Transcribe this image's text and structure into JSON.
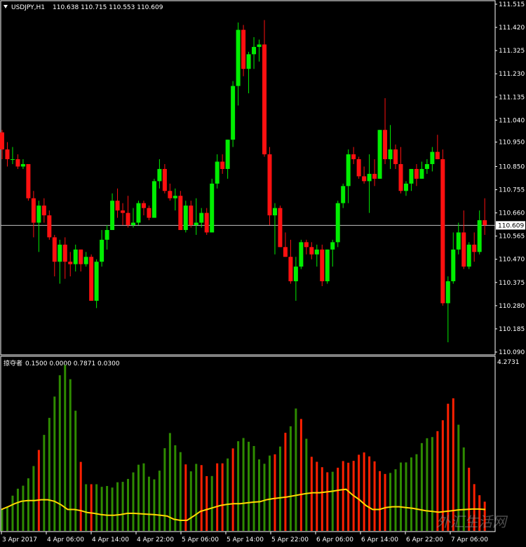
{
  "header": {
    "symbol": "USDJPY,H1",
    "ohlc": "110.638 110.715 110.553 110.609"
  },
  "indicator": {
    "name": "掠夺者",
    "params": "0.1500 0.0000 0.7871 0.0300",
    "max_label": "4.2731"
  },
  "watermark": "外汇生活网",
  "colors": {
    "background": "#000000",
    "bull": "#00ee00",
    "bear": "#ff1010",
    "bull_volume": "#2e8b00",
    "bear_volume": "#ff2000",
    "signal": "#ffd700",
    "price_line": "#c0c0c0",
    "label_box": "#ffffff"
  },
  "chart_data": [
    {
      "type": "candlestick",
      "title": "USDJPY,H1",
      "ylim": [
        110.09,
        111.515
      ],
      "yticks": [
        "111.515",
        "111.420",
        "111.325",
        "111.230",
        "111.135",
        "111.040",
        "110.950",
        "110.850",
        "110.755",
        "110.660",
        "110.565",
        "110.470",
        "110.375",
        "110.280",
        "110.185",
        "110.090"
      ],
      "current_price": "110.609",
      "xticks": [
        "3 Apr 2017",
        "4 Apr 06:00",
        "4 Apr 14:00",
        "4 Apr 22:00",
        "5 Apr 06:00",
        "5 Apr 14:00",
        "5 Apr 22:00",
        "6 Apr 06:00",
        "6 Apr 14:00",
        "6 Apr 22:00",
        "7 Apr 06:00"
      ],
      "ohlc": [
        [
          110.99,
          111.0,
          110.88,
          110.92
        ],
        [
          110.92,
          110.95,
          110.85,
          110.88
        ],
        [
          110.88,
          110.93,
          110.86,
          110.88
        ],
        [
          110.88,
          110.9,
          110.84,
          110.85
        ],
        [
          110.85,
          110.88,
          110.84,
          110.86
        ],
        [
          110.86,
          110.86,
          110.71,
          110.72
        ],
        [
          110.72,
          110.75,
          110.56,
          110.62
        ],
        [
          110.62,
          110.71,
          110.5,
          110.69
        ],
        [
          110.69,
          110.72,
          110.62,
          110.65
        ],
        [
          110.65,
          110.67,
          110.55,
          110.56
        ],
        [
          110.56,
          110.57,
          110.4,
          110.46
        ],
        [
          110.46,
          110.55,
          110.37,
          110.53
        ],
        [
          110.53,
          110.56,
          110.39,
          110.46
        ],
        [
          110.46,
          110.5,
          110.4,
          110.45
        ],
        [
          110.45,
          110.53,
          110.42,
          110.51
        ],
        [
          110.51,
          110.51,
          110.42,
          110.45
        ],
        [
          110.45,
          110.5,
          110.44,
          110.48
        ],
        [
          110.48,
          110.49,
          110.3,
          110.3
        ],
        [
          110.3,
          110.47,
          110.27,
          110.46
        ],
        [
          110.46,
          110.59,
          110.44,
          110.55
        ],
        [
          110.55,
          110.61,
          110.51,
          110.59
        ],
        [
          110.59,
          110.74,
          110.59,
          110.71
        ],
        [
          110.71,
          110.76,
          110.64,
          110.67
        ],
        [
          110.67,
          110.7,
          110.61,
          110.66
        ],
        [
          110.66,
          110.73,
          110.6,
          110.61
        ],
        [
          110.61,
          110.68,
          110.6,
          110.62
        ],
        [
          110.62,
          110.71,
          110.61,
          110.7
        ],
        [
          110.7,
          110.71,
          110.65,
          110.68
        ],
        [
          110.68,
          110.69,
          110.63,
          110.64
        ],
        [
          110.64,
          110.8,
          110.64,
          110.79
        ],
        [
          110.79,
          110.88,
          110.76,
          110.84
        ],
        [
          110.84,
          110.86,
          110.74,
          110.75
        ],
        [
          110.75,
          110.78,
          110.71,
          110.72
        ],
        [
          110.72,
          110.76,
          110.67,
          110.73
        ],
        [
          110.73,
          110.75,
          110.59,
          110.59
        ],
        [
          110.59,
          110.71,
          110.58,
          110.69
        ],
        [
          110.69,
          110.71,
          110.6,
          110.61
        ],
        [
          110.61,
          110.72,
          110.57,
          110.62
        ],
        [
          110.62,
          110.68,
          110.6,
          110.66
        ],
        [
          110.66,
          110.68,
          110.57,
          110.58
        ],
        [
          110.58,
          110.8,
          110.58,
          110.78
        ],
        [
          110.78,
          110.9,
          110.76,
          110.87
        ],
        [
          110.87,
          110.9,
          110.82,
          110.84
        ],
        [
          110.84,
          110.96,
          110.8,
          110.96
        ],
        [
          110.96,
          111.2,
          110.93,
          111.18
        ],
        [
          111.18,
          111.44,
          111.1,
          111.41
        ],
        [
          111.41,
          111.43,
          111.22,
          111.25
        ],
        [
          111.25,
          111.32,
          111.15,
          111.31
        ],
        [
          111.31,
          111.38,
          111.25,
          111.34
        ],
        [
          111.34,
          111.37,
          111.28,
          111.35
        ],
        [
          111.35,
          111.45,
          110.89,
          110.9
        ],
        [
          110.9,
          110.93,
          110.61,
          110.65
        ],
        [
          110.65,
          110.7,
          110.49,
          110.68
        ],
        [
          110.68,
          110.69,
          110.52,
          110.52
        ],
        [
          110.52,
          110.58,
          110.48,
          110.48
        ],
        [
          110.48,
          110.55,
          110.37,
          110.38
        ],
        [
          110.38,
          110.48,
          110.3,
          110.44
        ],
        [
          110.44,
          110.55,
          110.43,
          110.54
        ],
        [
          110.54,
          110.55,
          110.49,
          110.52
        ],
        [
          110.52,
          110.54,
          110.47,
          110.49
        ],
        [
          110.49,
          110.53,
          110.44,
          110.51
        ],
        [
          110.51,
          110.53,
          110.36,
          110.38
        ],
        [
          110.38,
          110.51,
          110.37,
          110.51
        ],
        [
          110.51,
          110.55,
          110.44,
          110.54
        ],
        [
          110.54,
          110.71,
          110.52,
          110.7
        ],
        [
          110.7,
          110.78,
          110.68,
          110.77
        ],
        [
          110.77,
          110.92,
          110.7,
          110.9
        ],
        [
          110.9,
          110.93,
          110.86,
          110.88
        ],
        [
          110.88,
          110.89,
          110.8,
          110.81
        ],
        [
          110.81,
          110.85,
          110.78,
          110.79
        ],
        [
          110.79,
          110.9,
          110.66,
          110.82
        ],
        [
          110.82,
          110.88,
          110.77,
          110.8
        ],
        [
          110.8,
          111.0,
          110.8,
          111.0
        ],
        [
          111.0,
          111.13,
          110.86,
          110.88
        ],
        [
          110.88,
          111.02,
          110.84,
          110.92
        ],
        [
          110.92,
          110.94,
          110.84,
          110.86
        ],
        [
          110.86,
          110.93,
          110.74,
          110.75
        ],
        [
          110.75,
          110.79,
          110.73,
          110.78
        ],
        [
          110.78,
          110.84,
          110.75,
          110.84
        ],
        [
          110.84,
          110.86,
          110.77,
          110.8
        ],
        [
          110.8,
          110.87,
          110.8,
          110.84
        ],
        [
          110.84,
          110.88,
          110.82,
          110.86
        ],
        [
          110.86,
          110.93,
          110.83,
          110.91
        ],
        [
          110.91,
          110.98,
          110.88,
          110.88
        ],
        [
          110.88,
          110.92,
          110.28,
          110.29
        ],
        [
          110.29,
          110.4,
          110.13,
          110.38
        ],
        [
          110.38,
          110.58,
          110.37,
          110.51
        ],
        [
          110.51,
          110.62,
          110.49,
          110.58
        ],
        [
          110.58,
          110.67,
          110.43,
          110.44
        ],
        [
          110.44,
          110.54,
          110.43,
          110.53
        ],
        [
          110.53,
          110.58,
          110.46,
          110.5
        ],
        [
          110.5,
          110.67,
          110.49,
          110.63
        ],
        [
          110.63,
          110.72,
          110.57,
          110.61
        ]
      ]
    },
    {
      "type": "bar",
      "title": "掠夺者",
      "ylim": [
        0,
        4.2731
      ],
      "bar_colors": [
        "green",
        "green",
        "green",
        "green",
        "green",
        "green",
        "green",
        "red",
        "green",
        "green",
        "green",
        "green",
        "green",
        "green",
        "green",
        "red",
        "green",
        "red",
        "green",
        "green",
        "green",
        "green",
        "green",
        "green",
        "green",
        "green",
        "green",
        "green",
        "green",
        "green",
        "green",
        "green",
        "green",
        "green",
        "green",
        "red",
        "green",
        "green",
        "red",
        "red",
        "green",
        "red",
        "red",
        "green",
        "red",
        "green",
        "green",
        "green",
        "green",
        "green",
        "green",
        "green",
        "red",
        "green",
        "red",
        "green",
        "green",
        "red",
        "green",
        "red",
        "red",
        "red",
        "red",
        "green",
        "red",
        "red",
        "red",
        "red",
        "red",
        "red",
        "red",
        "red",
        "red",
        "red",
        "green",
        "green",
        "green",
        "green",
        "green",
        "green",
        "green",
        "green",
        "green",
        "red",
        "red",
        "red",
        "red",
        "green",
        "green",
        "red",
        "red",
        "red",
        "red"
      ],
      "values": [
        2.06,
        2.32,
        3.39,
        4.06,
        4.35,
        5.06,
        6.24,
        7.79,
        9.24,
        10.88,
        12.93,
        14.98,
        15.97,
        14.6,
        11.57,
        6.64,
        4.49,
        4.49,
        4.49,
        4.24,
        4.32,
        4.17,
        4.68,
        4.72,
        5.0,
        5.63,
        6.37,
        6.5,
        5.22,
        4.96,
        5.8,
        7.96,
        9.42,
        8.24,
        7.58,
        6.4,
        5.73,
        6.45,
        6.33,
        5.27,
        5.28,
        6.5,
        6.5,
        6.97,
        7.94,
        8.63,
        8.94,
        8.58,
        8.17,
        6.88,
        6.46,
        7.25,
        7.37,
        8.12,
        9.44,
        10.07,
        11.78,
        10.77,
        8.87,
        7.13,
        6.65,
        6.13,
        5.64,
        5.69,
        6.08,
        6.72,
        6.56,
        6.74,
        7.33,
        7.55,
        7.17,
        6.69,
        5.75,
        5.48,
        5.58,
        5.93,
        6.58,
        6.59,
        7.07,
        7.38,
        8.45,
        8.92,
        9.03,
        9.6,
        10.65,
        12.24,
        12.76,
        10.22,
        8.03,
        6.08,
        4.5,
        3.43,
        2.81
      ],
      "signal": [
        0.55,
        0.62,
        0.7,
        0.76,
        0.78,
        0.78,
        0.8,
        0.8,
        0.76,
        0.67,
        0.55,
        0.55,
        0.52,
        0.47,
        0.45,
        0.42,
        0.4,
        0.4,
        0.42,
        0.45,
        0.45,
        0.44,
        0.43,
        0.42,
        0.4,
        0.38,
        0.3,
        0.27,
        0.27,
        0.38,
        0.5,
        0.55,
        0.6,
        0.65,
        0.68,
        0.7,
        0.7,
        0.72,
        0.74,
        0.75,
        0.8,
        0.83,
        0.85,
        0.87,
        0.9,
        0.93,
        0.96,
        0.98,
        0.98,
        1.0,
        1.02,
        1.05,
        1.07,
        0.92,
        0.8,
        0.65,
        0.55,
        0.55,
        0.6,
        0.62,
        0.62,
        0.6,
        0.58,
        0.55,
        0.52,
        0.5,
        0.48,
        0.5,
        0.52,
        0.54,
        0.55,
        0.56,
        0.56,
        0.55
      ]
    }
  ]
}
